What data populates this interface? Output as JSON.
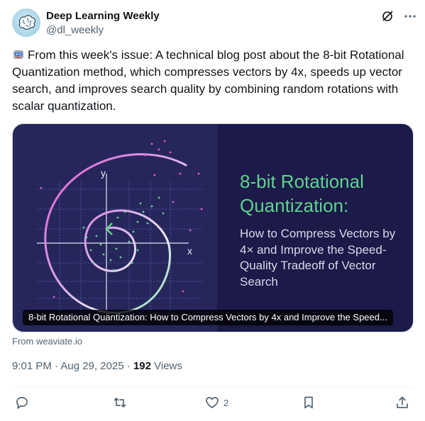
{
  "author": {
    "display_name": "Deep Learning Weekly",
    "handle": "@dl_weekly"
  },
  "header_icons": [
    "grok-icon",
    "more-icon"
  ],
  "tweet": {
    "emoji": "robot-emoji",
    "text": "From this week's issue: A technical blog post about the 8-bit Rotational Quantization method, which compresses vectors by 4x, speeds up vector search, and improves search quality by combining random rotations with scalar quantization."
  },
  "card": {
    "title": "8-bit Rotational Quantization:",
    "subtitle": "How to Compress Vectors by 4× and Improve the Speed-Quality Tradeoff of Vector Search",
    "caption": "8-bit Rotational Quantization: How to Compress Vectors by 4x and Improve the Speed...",
    "axis_x": "x",
    "axis_y": "y",
    "colors": {
      "left_bg": "#27265b",
      "right_bg": "#1b1a49",
      "accent_green": "#5fd38e",
      "accent_pink": "#e35bd0"
    }
  },
  "source": "From weaviate.io",
  "meta": {
    "time": "9:01 PM · Aug 29, 2025 · ",
    "views_count": "192",
    "views_label": " Views"
  },
  "actions": {
    "reply_count": "",
    "repost_count": "",
    "like_count": "2",
    "bookmark_count": ""
  }
}
